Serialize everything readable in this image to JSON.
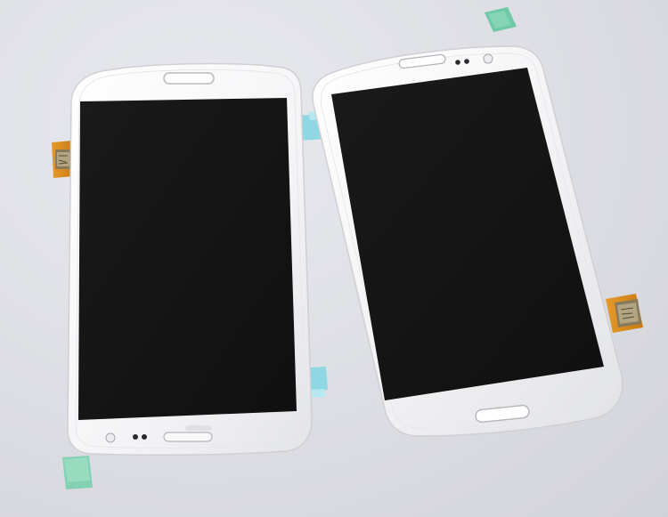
{
  "scene": {
    "subject": "",
    "colors": {
      "background": "#dcdde2",
      "panel_frame": "#f7f7f8",
      "panel_edge": "#cfd0d5",
      "screen": "#151515",
      "protective_tab_cyan": "#8fd7e3",
      "protective_tab_green": "#6fc8a6",
      "flex_cable": "#e08a1a",
      "flex_cable_dark": "#6b5a3c"
    },
    "icons": [
      "earpiece-slot",
      "front-camera",
      "sensor-dots",
      "home-button-slot"
    ]
  }
}
